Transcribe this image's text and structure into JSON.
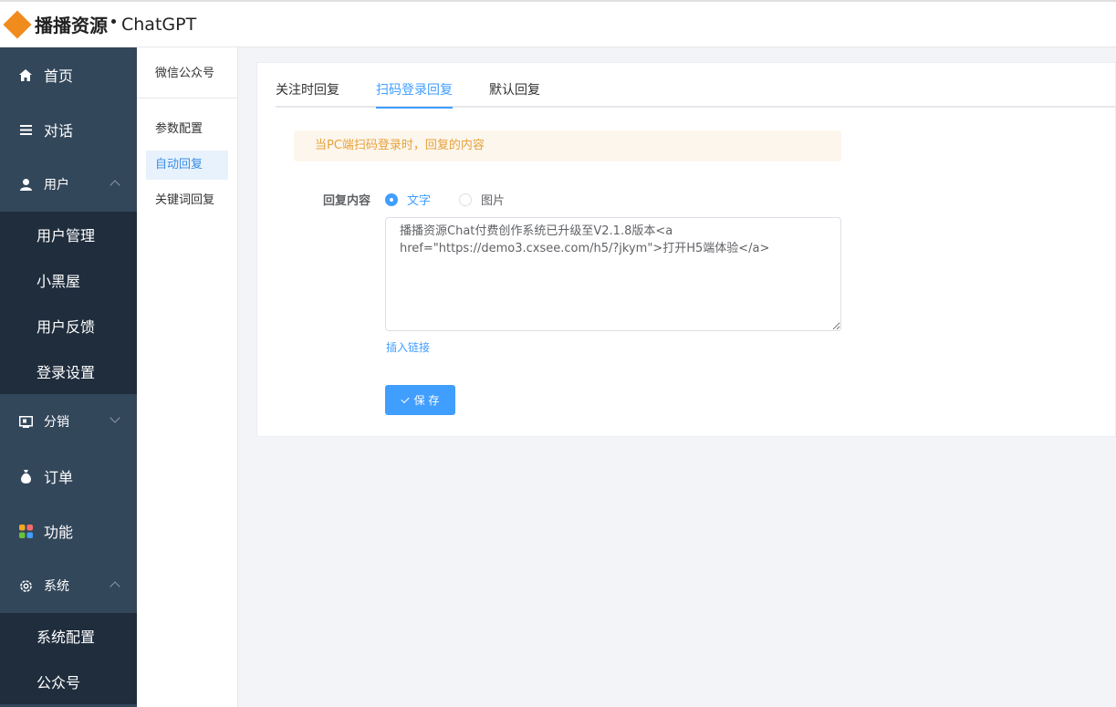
{
  "header": {
    "brand_cn": "播播资源",
    "brand_en": "ChatGPT"
  },
  "sidebar": {
    "items": [
      {
        "label": "首页",
        "icon": "home-icon"
      },
      {
        "label": "对话",
        "icon": "list-icon"
      },
      {
        "label": "用户",
        "icon": "user-icon",
        "expanded": true
      },
      {
        "label": "分销",
        "icon": "distribution-icon",
        "expanded": false
      },
      {
        "label": "订单",
        "icon": "money-bag-icon"
      },
      {
        "label": "功能",
        "icon": "apps-icon"
      },
      {
        "label": "系统",
        "icon": "gear-icon",
        "expanded": true
      }
    ],
    "user_sub": [
      "用户管理",
      "小黑屋",
      "用户反馈",
      "登录设置"
    ],
    "system_sub": [
      "系统配置",
      "公众号"
    ]
  },
  "secondary_menu": {
    "title": "微信公众号",
    "items": [
      "参数配置",
      "自动回复",
      "关键词回复"
    ],
    "active": "自动回复"
  },
  "tabs": {
    "items": [
      "关注时回复",
      "扫码登录回复",
      "默认回复"
    ],
    "active": "扫码登录回复"
  },
  "form": {
    "notice": "当PC端扫码登录时，回复的内容",
    "label": "回复内容",
    "radio_text": "文字",
    "radio_image": "图片",
    "selected": "文字",
    "content": "播播资源Chat付费创作系统已升级至V2.1.8版本<a href=\"https://demo3.cxsee.com/h5/?jkym\">打开H5端体验</a>",
    "insert_link": "插入链接",
    "save": "保 存"
  },
  "colors": {
    "sidebar": "#33475b",
    "sidebar_sub": "#1f2d3d",
    "accent": "#409eff",
    "brand": "#f08c1e",
    "notice_bg": "#fdf6ec",
    "notice_text": "#e6a23c"
  }
}
